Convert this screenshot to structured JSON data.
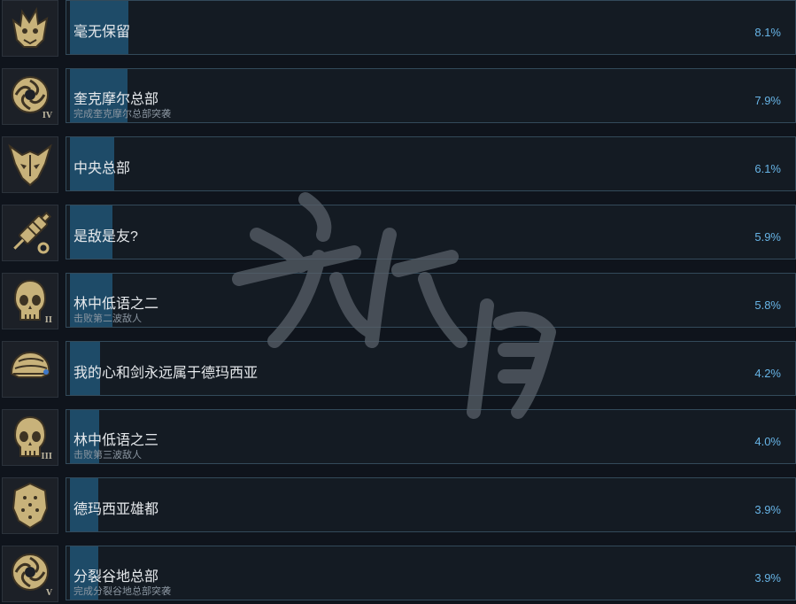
{
  "achievements": [
    {
      "title": "毫无保留",
      "desc": "",
      "percent": "8.1%",
      "fraction": 0.081,
      "icon": "dragon-helm-icon",
      "roman": ""
    },
    {
      "title": "奎克摩尔总部",
      "desc": "完成奎克摩尔总部突袭",
      "percent": "7.9%",
      "fraction": 0.079,
      "icon": "spiral-emblem-icon",
      "roman": "IV"
    },
    {
      "title": "中央总部",
      "desc": "",
      "percent": "6.1%",
      "fraction": 0.061,
      "icon": "horned-mask-icon",
      "roman": ""
    },
    {
      "title": "是敌是友?",
      "desc": "",
      "percent": "5.9%",
      "fraction": 0.059,
      "icon": "syringe-icon",
      "roman": ""
    },
    {
      "title": "林中低语之二",
      "desc": "击败第二波敌人",
      "percent": "5.8%",
      "fraction": 0.058,
      "icon": "skull-icon",
      "roman": "II"
    },
    {
      "title": "我的心和剑永远属于德玛西亚",
      "desc": "",
      "percent": "4.2%",
      "fraction": 0.042,
      "icon": "knight-helmet-icon",
      "roman": ""
    },
    {
      "title": "林中低语之三",
      "desc": "击败第三波敌人",
      "percent": "4.0%",
      "fraction": 0.04,
      "icon": "skull-icon",
      "roman": "III"
    },
    {
      "title": "德玛西亚雄都",
      "desc": "",
      "percent": "3.9%",
      "fraction": 0.039,
      "icon": "shield-icon",
      "roman": ""
    },
    {
      "title": "分裂谷地总部",
      "desc": "完成分裂谷地总部突袭",
      "percent": "3.9%",
      "fraction": 0.039,
      "icon": "spiral-emblem-icon",
      "roman": "V"
    }
  ],
  "colors": {
    "background": "#0f141c",
    "fill": "#1e4b68",
    "percent": "#67b4e6",
    "icon_gold": "#c8b27a"
  }
}
